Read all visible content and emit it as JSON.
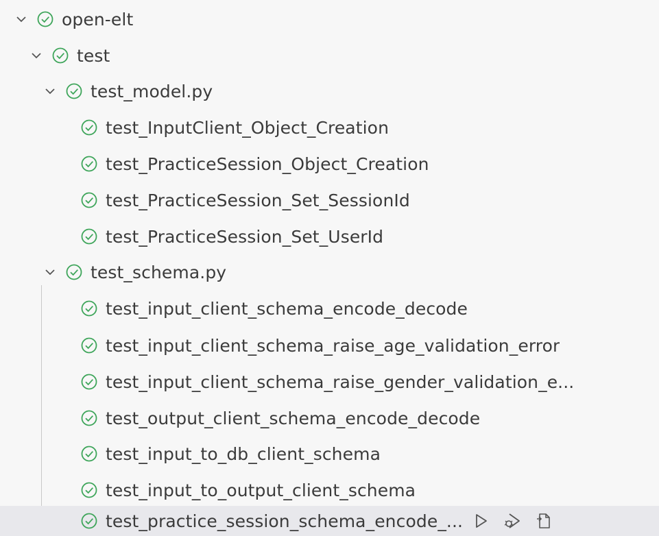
{
  "colors": {
    "pass": "#3ea55a",
    "text": "#3b3b3b",
    "icon": "#555555",
    "hover_bg": "#e8e8ec",
    "guide": "#c8c8c8"
  },
  "tree": {
    "root": {
      "label": "open-elt",
      "expanded": true,
      "status_icon": "pass-circle-icon"
    },
    "test_folder": {
      "label": "test",
      "expanded": true,
      "status_icon": "pass-circle-icon"
    },
    "test_model": {
      "label": "test_model.py",
      "expanded": true,
      "status_icon": "pass-circle-icon",
      "tests": [
        {
          "label": "test_InputClient_Object_Creation"
        },
        {
          "label": "test_PracticeSession_Object_Creation"
        },
        {
          "label": "test_PracticeSession_Set_SessionId"
        },
        {
          "label": "test_PracticeSession_Set_UserId"
        }
      ]
    },
    "test_schema": {
      "label": "test_schema.py",
      "expanded": true,
      "status_icon": "pass-circle-icon",
      "tests": [
        {
          "label": "test_input_client_schema_encode_decode"
        },
        {
          "label": "test_input_client_schema_raise_age_validation_error"
        },
        {
          "label": "test_input_client_schema_raise_gender_validation_e..."
        },
        {
          "label": "test_output_client_schema_encode_decode"
        },
        {
          "label": "test_input_to_db_client_schema"
        },
        {
          "label": "test_input_to_output_client_schema"
        },
        {
          "label": "test_practice_session_schema_encode_..."
        }
      ]
    }
  },
  "hover_actions": {
    "run_icon": "run-test-icon",
    "debug_icon": "debug-test-icon",
    "goto_icon": "go-to-test-icon"
  }
}
